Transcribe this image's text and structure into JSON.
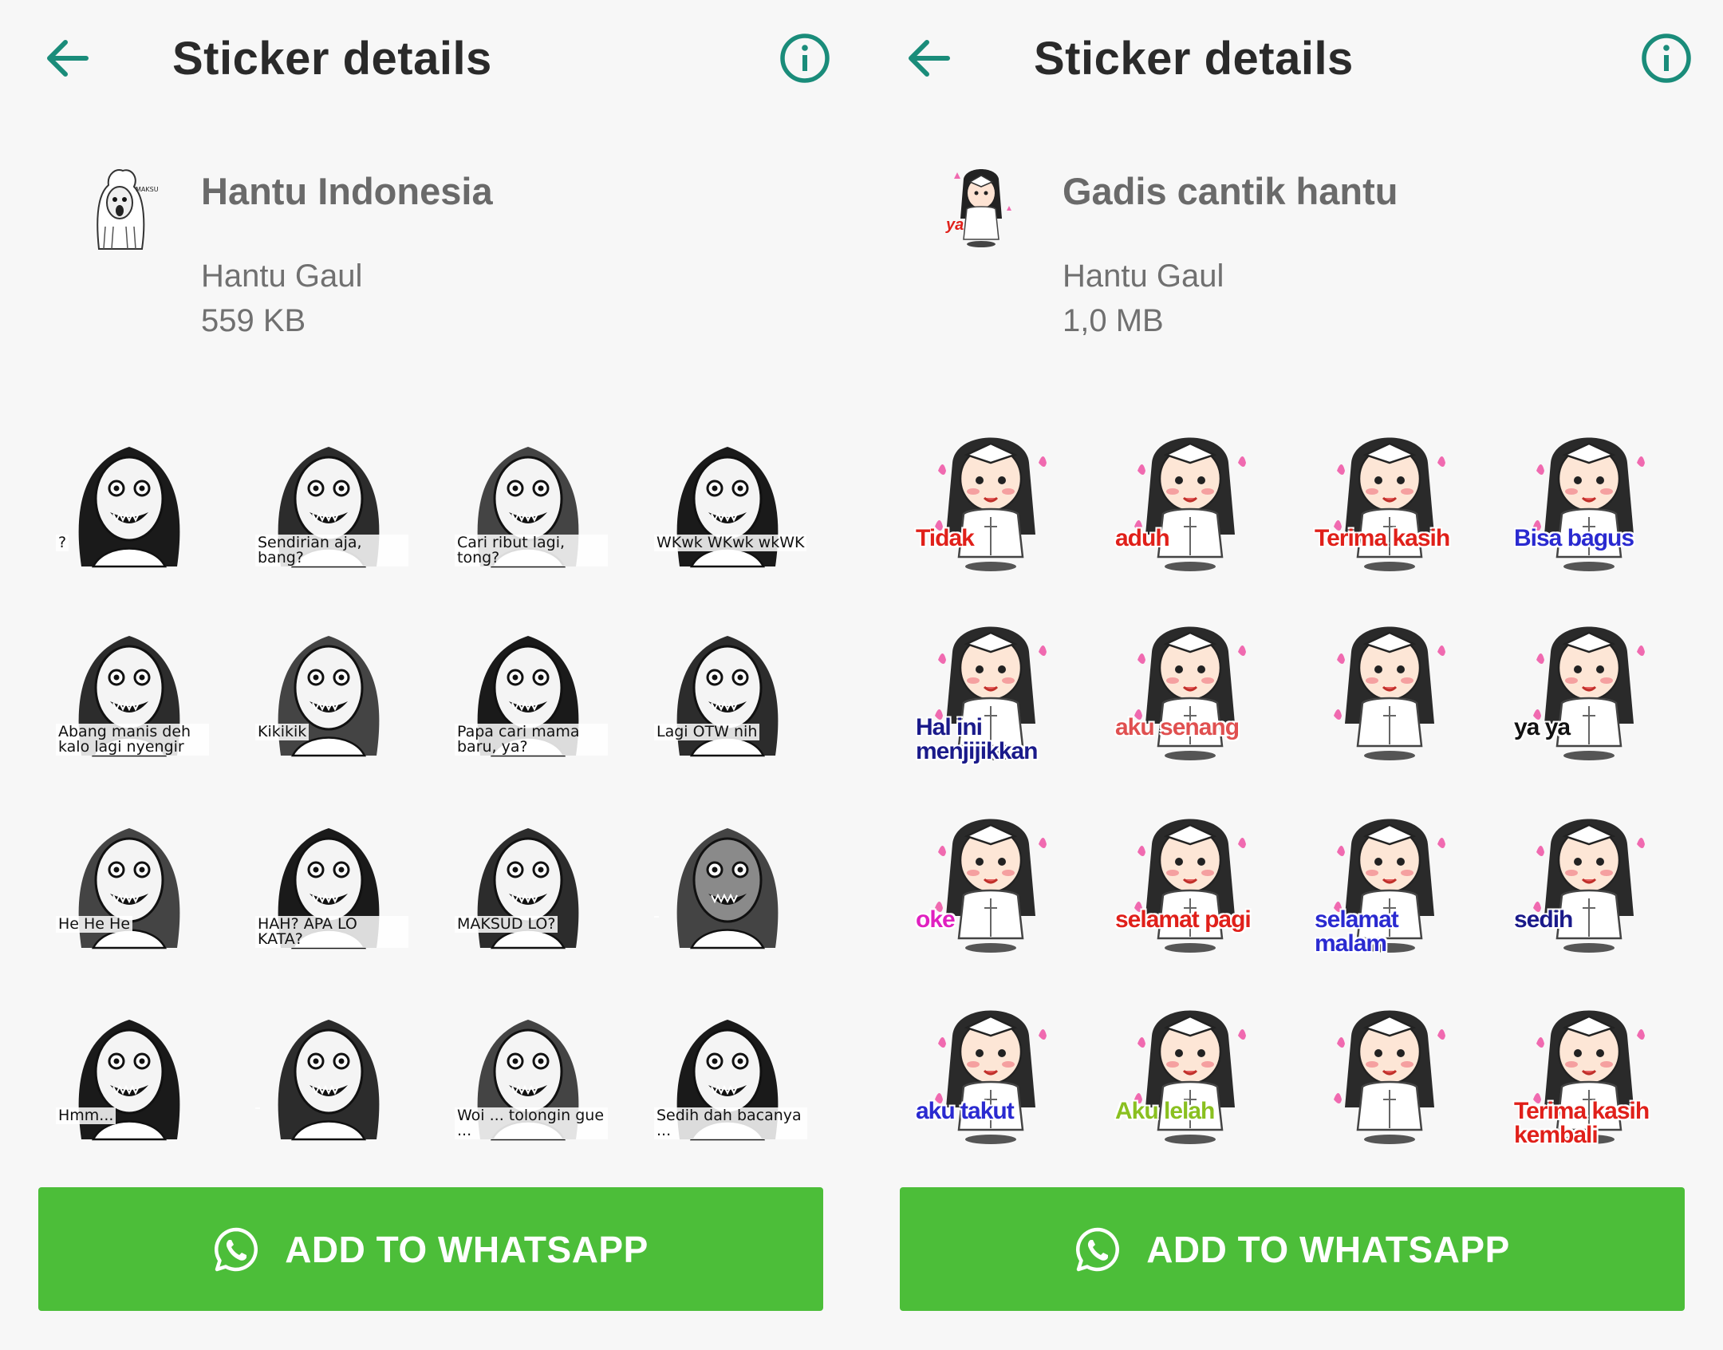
{
  "colors": {
    "accent": "#1a8c7a",
    "button": "#4cbe39",
    "button_text": "#ffffff"
  },
  "screens": [
    {
      "title": "Sticker details",
      "pack_name": "Hantu Indonesia",
      "author": "Hantu Gaul",
      "size": "559 KB",
      "tray_caption": "MAKSUD LO?",
      "stickers": [
        {
          "caption": "?"
        },
        {
          "caption": "Sendirian aja, bang?"
        },
        {
          "caption": "Cari ribut lagi, tong?"
        },
        {
          "caption": "WKwk WKwk wkWK"
        },
        {
          "caption": "Abang manis deh kalo lagi nyengir"
        },
        {
          "caption": "Kikikik"
        },
        {
          "caption": "Papa cari mama baru, ya?"
        },
        {
          "caption": "Lagi OTW nih"
        },
        {
          "caption": "He He He"
        },
        {
          "caption": "HAH? APA LO KATA?"
        },
        {
          "caption": "MAKSUD LO?"
        },
        {
          "caption": ""
        },
        {
          "caption": "Hmm..."
        },
        {
          "caption": ""
        },
        {
          "caption": "Woi ... tolongin gue ..."
        },
        {
          "caption": "Sedih dah bacanya ..."
        }
      ],
      "button_label": "ADD TO WHATSAPP"
    },
    {
      "title": "Sticker details",
      "pack_name": "Gadis cantik hantu",
      "author": "Hantu Gaul",
      "size": "1,0 MB",
      "tray_caption": "ya",
      "stickers": [
        {
          "caption": "Tidak",
          "color": "#e0201a"
        },
        {
          "caption": "aduh",
          "color": "#e0201a"
        },
        {
          "caption": "Terima kasih",
          "color": "#e0201a"
        },
        {
          "caption": "Bisa bagus",
          "color": "#2a2ad0"
        },
        {
          "caption": "Hal ini menjijikkan",
          "color": "#1a1a8a"
        },
        {
          "caption": "aku senang",
          "color": "#e05050"
        },
        {
          "caption": "",
          "color": "#e0201a"
        },
        {
          "caption": "ya ya",
          "color": "#111111"
        },
        {
          "caption": "oke",
          "color": "#e020c0"
        },
        {
          "caption": "selamat pagi",
          "color": "#e0201a"
        },
        {
          "caption": "selamat malam",
          "color": "#2a2ad0"
        },
        {
          "caption": "sedih",
          "color": "#1a1a8a"
        },
        {
          "caption": "aku takut",
          "color": "#2a2ad0"
        },
        {
          "caption": "Aku lelah",
          "color": "#8ac020"
        },
        {
          "caption": "",
          "color": "#e0201a"
        },
        {
          "caption": "Terima kasih kembali",
          "color": "#e0201a"
        }
      ],
      "button_label": "ADD TO WHATSAPP"
    }
  ]
}
